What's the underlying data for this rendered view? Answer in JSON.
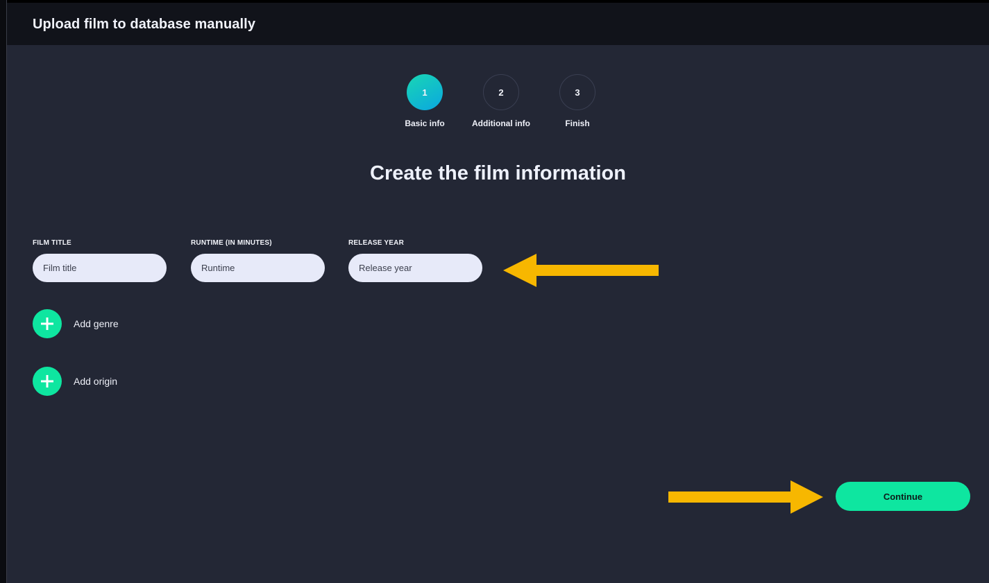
{
  "header": {
    "title": "Upload film to database manually"
  },
  "stepper": {
    "steps": [
      {
        "number": "1",
        "label": "Basic info",
        "active": true
      },
      {
        "number": "2",
        "label": "Additional info",
        "active": false
      },
      {
        "number": "3",
        "label": "Finish",
        "active": false
      }
    ]
  },
  "main": {
    "heading": "Create the film information",
    "fields": [
      {
        "label": "FILM TITLE",
        "placeholder": "Film title",
        "value": ""
      },
      {
        "label": "RUNTIME (IN MINUTES)",
        "placeholder": "Runtime",
        "value": ""
      },
      {
        "label": "RELEASE YEAR",
        "placeholder": "Release year",
        "value": ""
      }
    ],
    "add_genre_label": "Add genre",
    "add_origin_label": "Add origin",
    "continue_label": "Continue"
  },
  "colors": {
    "background": "#232735",
    "topbar": "#11131a",
    "accent_green": "#0ee6a0",
    "active_step_gradient": [
      "#19d6b4",
      "#0aa7e0"
    ],
    "annotation_arrow": "#f7b700",
    "input_bg": "#e7eaf9"
  },
  "icons": {
    "add_genre": "plus-icon",
    "add_origin": "plus-icon",
    "annotation_left": "arrow-left-icon",
    "annotation_right": "arrow-right-icon"
  }
}
